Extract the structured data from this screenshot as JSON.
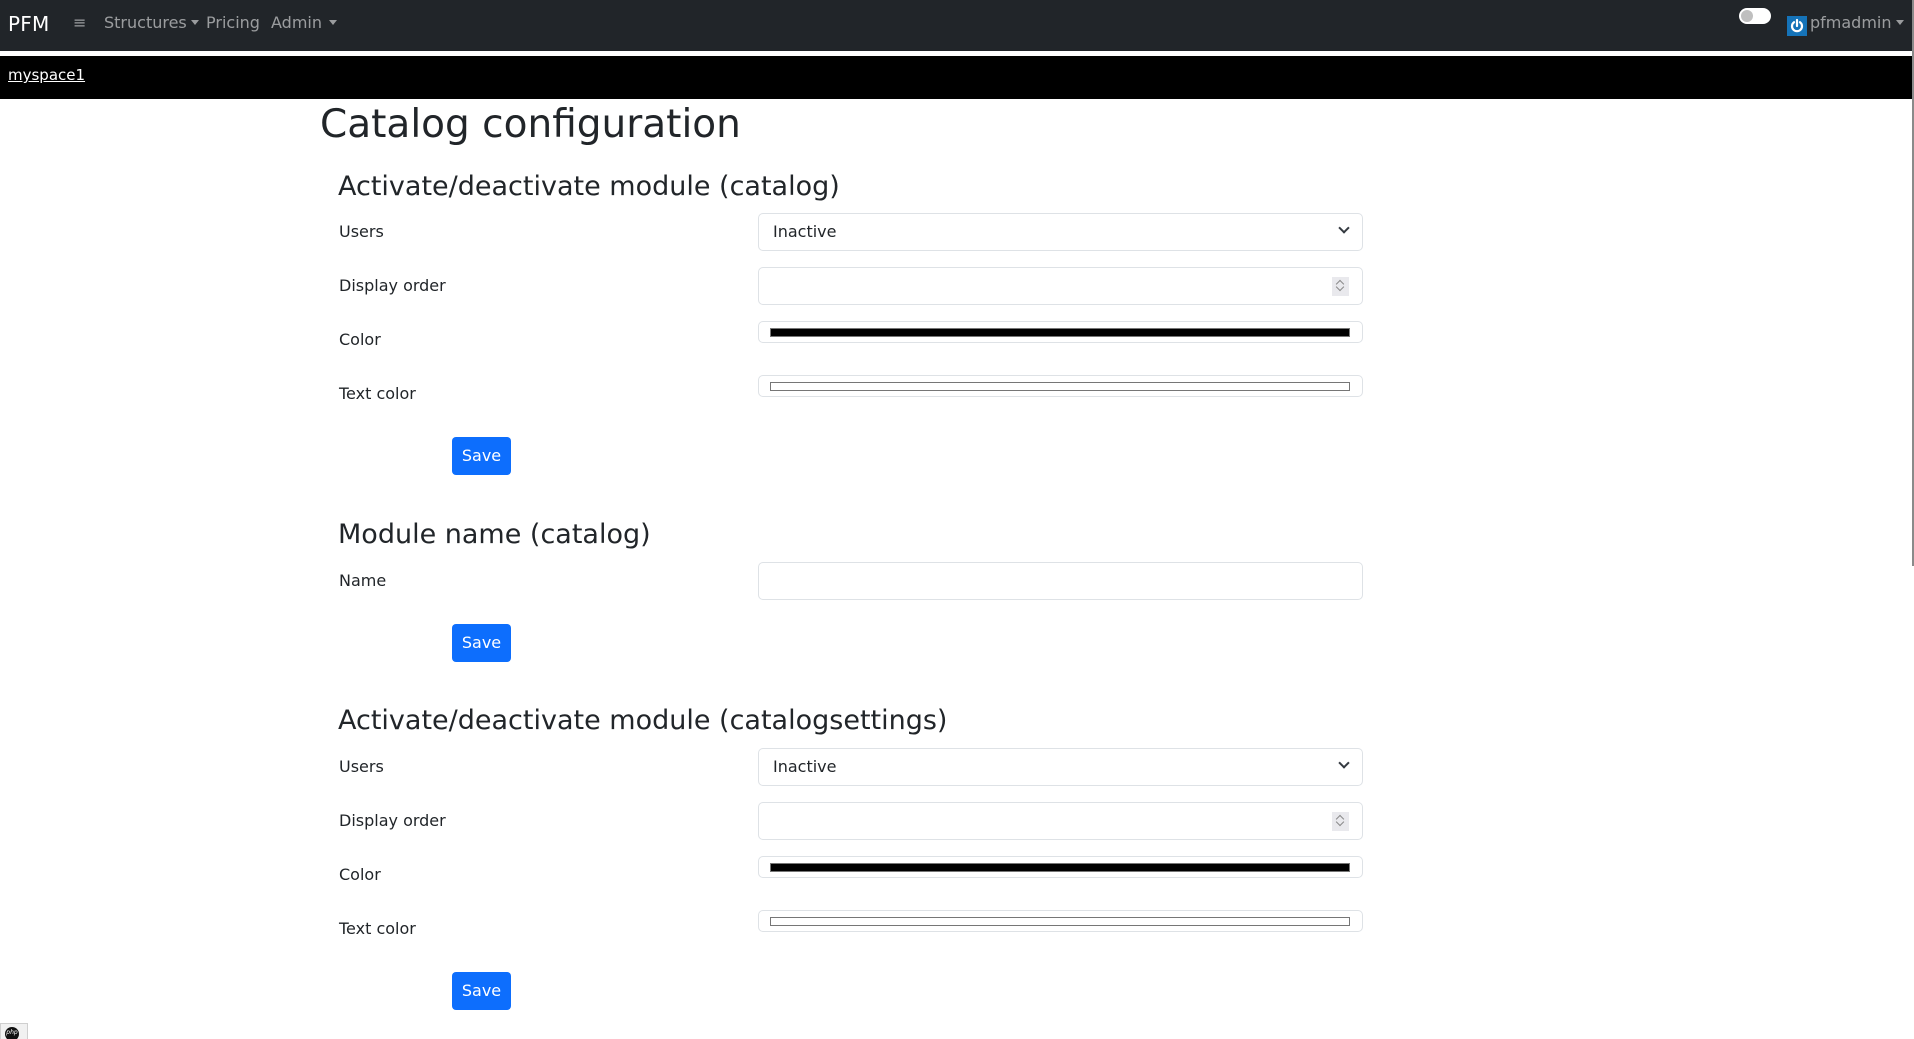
{
  "navbar": {
    "brand": "PFM",
    "menu_icon": "hamburger-icon",
    "links": [
      {
        "label": "Structures",
        "has_dropdown": true
      },
      {
        "label": "Pricing",
        "has_dropdown": false
      },
      {
        "label": "Admin",
        "has_dropdown": true
      }
    ],
    "theme_toggle": {
      "on": false
    },
    "user": {
      "name": "pfmadmin",
      "icon": "power-icon",
      "icon_color": "#1573b8"
    }
  },
  "space_bar": {
    "link": "myspace1"
  },
  "page": {
    "title": "Catalog configuration"
  },
  "sections": [
    {
      "title": "Activate/deactivate module (catalog)",
      "fields": [
        {
          "label": "Users",
          "type": "select",
          "value": "Inactive"
        },
        {
          "label": "Display order",
          "type": "number",
          "value": ""
        },
        {
          "label": "Color",
          "type": "color",
          "value": "#000000"
        },
        {
          "label": "Text color",
          "type": "color",
          "value": "#ffffff"
        }
      ],
      "button": "Save"
    },
    {
      "title": "Module name (catalog)",
      "fields": [
        {
          "label": "Name",
          "type": "text",
          "value": ""
        }
      ],
      "button": "Save"
    },
    {
      "title": "Activate/deactivate module (catalogsettings)",
      "fields": [
        {
          "label": "Users",
          "type": "select",
          "value": "Inactive"
        },
        {
          "label": "Display order",
          "type": "number",
          "value": ""
        },
        {
          "label": "Color",
          "type": "color",
          "value": "#000000"
        },
        {
          "label": "Text color",
          "type": "color",
          "value": "#ffffff"
        }
      ],
      "button": "Save"
    }
  ],
  "colors": {
    "navbar_bg": "#212529",
    "space_bar_bg": "#000000",
    "primary_button": "#0d6efd"
  },
  "footer": {
    "badge_icon": "php-icon",
    "badge_text": "php"
  }
}
